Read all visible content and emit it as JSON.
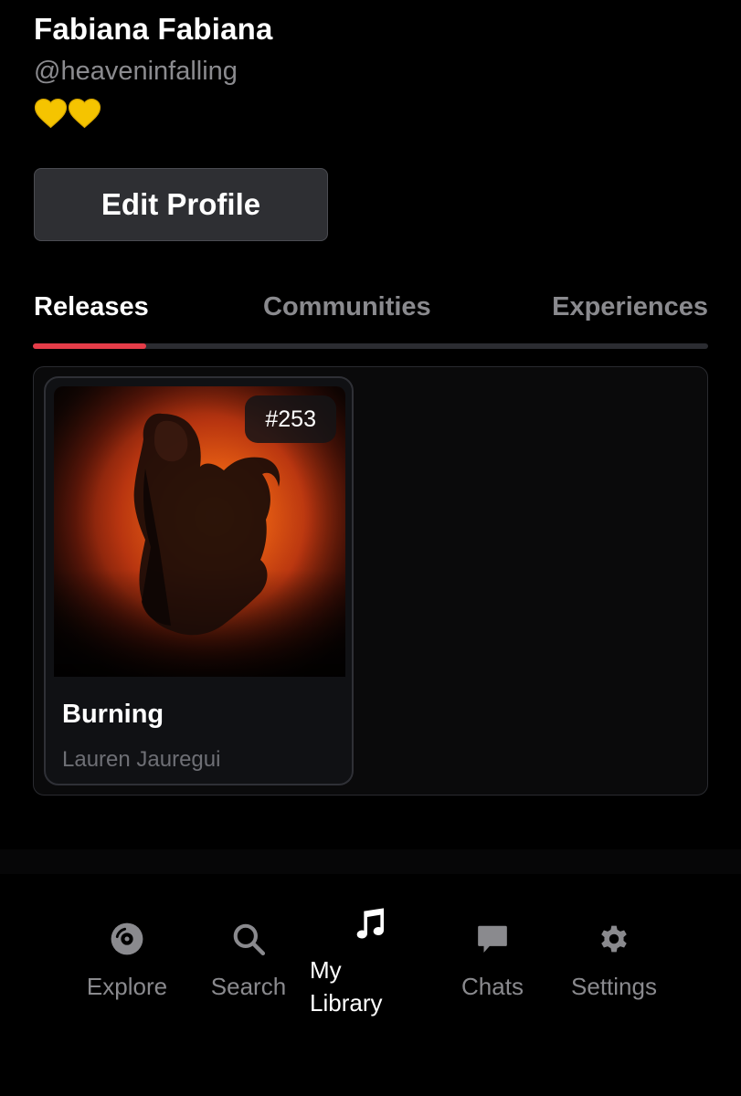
{
  "profile": {
    "name": "Fabiana Fabiana",
    "handle": "@heaveninfalling",
    "bio_emoji": "💛💛"
  },
  "edit_profile_label": "Edit Profile",
  "tabs": [
    {
      "label": "Releases",
      "active": true
    },
    {
      "label": "Communities",
      "active": false
    },
    {
      "label": "Experiences",
      "active": false
    }
  ],
  "releases": [
    {
      "badge": "#253",
      "title": "Burning",
      "artist": "Lauren Jauregui"
    }
  ],
  "nav": [
    {
      "label": "Explore",
      "icon": "disc-icon",
      "active": false
    },
    {
      "label": "Search",
      "icon": "search-icon",
      "active": false
    },
    {
      "label": "My Library",
      "icon": "music-note-icon",
      "active": true
    },
    {
      "label": "Chats",
      "icon": "chat-bubble-icon",
      "active": false
    },
    {
      "label": "Settings",
      "icon": "gear-icon",
      "active": false
    }
  ],
  "colors": {
    "accent": "#e53c48",
    "background": "#000000",
    "muted_text": "#8a8a8e",
    "heart": "#f5c400"
  }
}
